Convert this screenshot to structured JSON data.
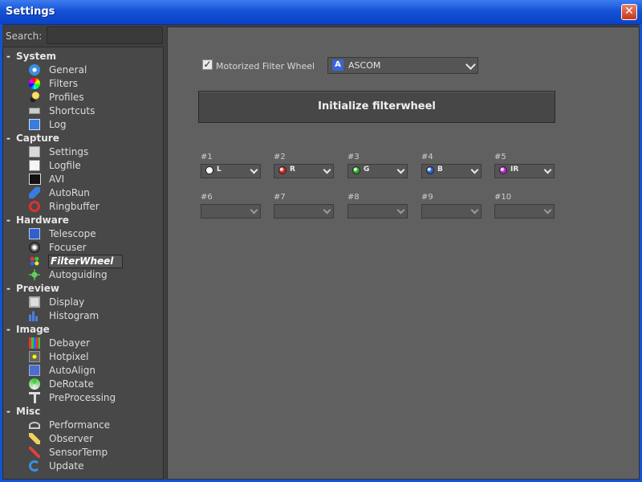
{
  "window": {
    "title": "Settings",
    "close_glyph": "✕"
  },
  "search": {
    "label": "Search:",
    "value": "",
    "placeholder": ""
  },
  "sidebar": {
    "categories": [
      {
        "label": "System",
        "items": [
          {
            "label": "General",
            "icon": "gear-icon"
          },
          {
            "label": "Filters",
            "icon": "color-wheel-icon"
          },
          {
            "label": "Profiles",
            "icon": "profile-icon"
          },
          {
            "label": "Shortcuts",
            "icon": "keyboard-icon"
          },
          {
            "label": "Log",
            "icon": "info-icon"
          }
        ]
      },
      {
        "label": "Capture",
        "items": [
          {
            "label": "Settings",
            "icon": "capture-settings-icon"
          },
          {
            "label": "Logfile",
            "icon": "logfile-icon"
          },
          {
            "label": "AVI",
            "icon": "avi-icon"
          },
          {
            "label": "AutoRun",
            "icon": "autorun-icon"
          },
          {
            "label": "Ringbuffer",
            "icon": "ringbuffer-icon"
          }
        ]
      },
      {
        "label": "Hardware",
        "items": [
          {
            "label": "Telescope",
            "icon": "telescope-icon"
          },
          {
            "label": "Focuser",
            "icon": "focuser-icon"
          },
          {
            "label": "FilterWheel",
            "icon": "filterwheel-icon",
            "selected": true
          },
          {
            "label": "Autoguiding",
            "icon": "autoguiding-icon"
          }
        ]
      },
      {
        "label": "Preview",
        "items": [
          {
            "label": "Display",
            "icon": "monitor-icon"
          },
          {
            "label": "Histogram",
            "icon": "histogram-icon"
          }
        ]
      },
      {
        "label": "Image",
        "items": [
          {
            "label": "Debayer",
            "icon": "debayer-icon"
          },
          {
            "label": "Hotpixel",
            "icon": "hotpixel-icon"
          },
          {
            "label": "AutoAlign",
            "icon": "autoalign-icon"
          },
          {
            "label": "DeRotate",
            "icon": "derotate-icon"
          },
          {
            "label": "PreProcessing",
            "icon": "funnel-icon"
          }
        ]
      },
      {
        "label": "Misc",
        "items": [
          {
            "label": "Performance",
            "icon": "gauge-icon"
          },
          {
            "label": "Observer",
            "icon": "observer-icon"
          },
          {
            "label": "SensorTemp",
            "icon": "thermometer-icon"
          },
          {
            "label": "Update",
            "icon": "refresh-icon"
          }
        ]
      }
    ]
  },
  "filterwheel": {
    "motorized_label": "Motorized Filter Wheel",
    "motorized_checked": true,
    "driver": {
      "value": "ASCOM",
      "logo_glyph": "A"
    },
    "init_button": "Initialize filterwheel",
    "slots": [
      {
        "label": "#1",
        "value": "L",
        "color": "#ffffff"
      },
      {
        "label": "#2",
        "value": "R",
        "color": "#e02020"
      },
      {
        "label": "#3",
        "value": "G",
        "color": "#20b020"
      },
      {
        "label": "#4",
        "value": "B",
        "color": "#2060e0"
      },
      {
        "label": "#5",
        "value": "IR",
        "color": "#c020d0"
      },
      {
        "label": "#6",
        "value": "",
        "color": ""
      },
      {
        "label": "#7",
        "value": "",
        "color": ""
      },
      {
        "label": "#8",
        "value": "",
        "color": ""
      },
      {
        "label": "#9",
        "value": "",
        "color": ""
      },
      {
        "label": "#10",
        "value": "",
        "color": ""
      }
    ]
  }
}
